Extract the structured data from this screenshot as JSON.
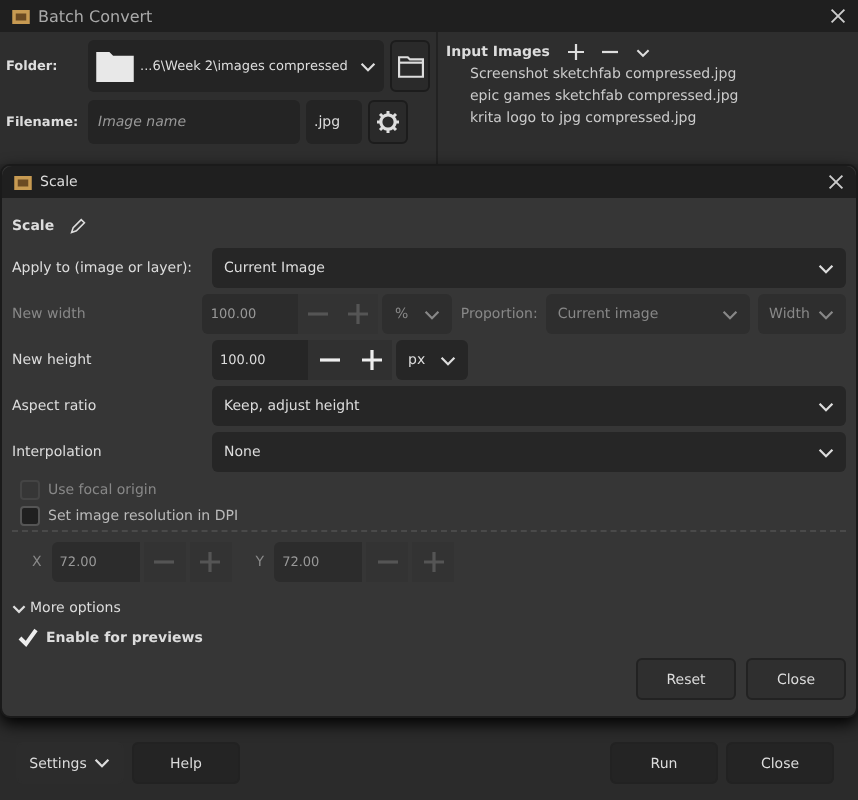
{
  "main_window": {
    "title": "Batch Convert",
    "folder_label": "Folder:",
    "folder_path": "...6\\Week 2\\images compressed",
    "filename_label": "Filename:",
    "filename_placeholder": "Image name",
    "extension": ".jpg",
    "input_images_label": "Input Images",
    "input_images": [
      "Screenshot sketchfab compressed.jpg",
      "epic games sketchfab compressed.jpg",
      "krita logo to jpg compressed.jpg"
    ],
    "footer_buttons": [
      {
        "label": "Settings",
        "kind": "menu"
      },
      {
        "label": "Help",
        "kind": "plain"
      },
      {
        "label": "Run",
        "kind": "plain"
      },
      {
        "label": "Close",
        "kind": "plain"
      }
    ]
  },
  "scale_dialog": {
    "title": "Scale",
    "heading": "Scale",
    "apply_to": {
      "label": "Apply to (image or layer):",
      "value": "Current Image"
    },
    "new_width": {
      "label": "New width",
      "value": "100.00",
      "unit": "%",
      "disabled": true,
      "proportion_label": "Proportion:",
      "proportion_value": "Current image",
      "dimension": "Width"
    },
    "new_height": {
      "label": "New height",
      "value": "100.00",
      "unit": "px",
      "disabled": false
    },
    "aspect_ratio": {
      "label": "Aspect ratio",
      "value": "Keep, adjust height"
    },
    "interpolation": {
      "label": "Interpolation",
      "value": "None"
    },
    "use_focal_origin": {
      "label": "Use focal origin",
      "checked": false,
      "disabled": true
    },
    "set_resolution": {
      "label": "Set image resolution in DPI",
      "checked": false,
      "disabled": false
    },
    "resolution": {
      "x_label": "X",
      "x_value": "72.00",
      "y_label": "Y",
      "y_value": "72.00",
      "disabled": true
    },
    "more_options": {
      "label": "More options",
      "expanded": true
    },
    "enable_previews": {
      "label": "Enable for previews",
      "checked": true
    },
    "buttons": [
      "Reset",
      "Close"
    ]
  }
}
